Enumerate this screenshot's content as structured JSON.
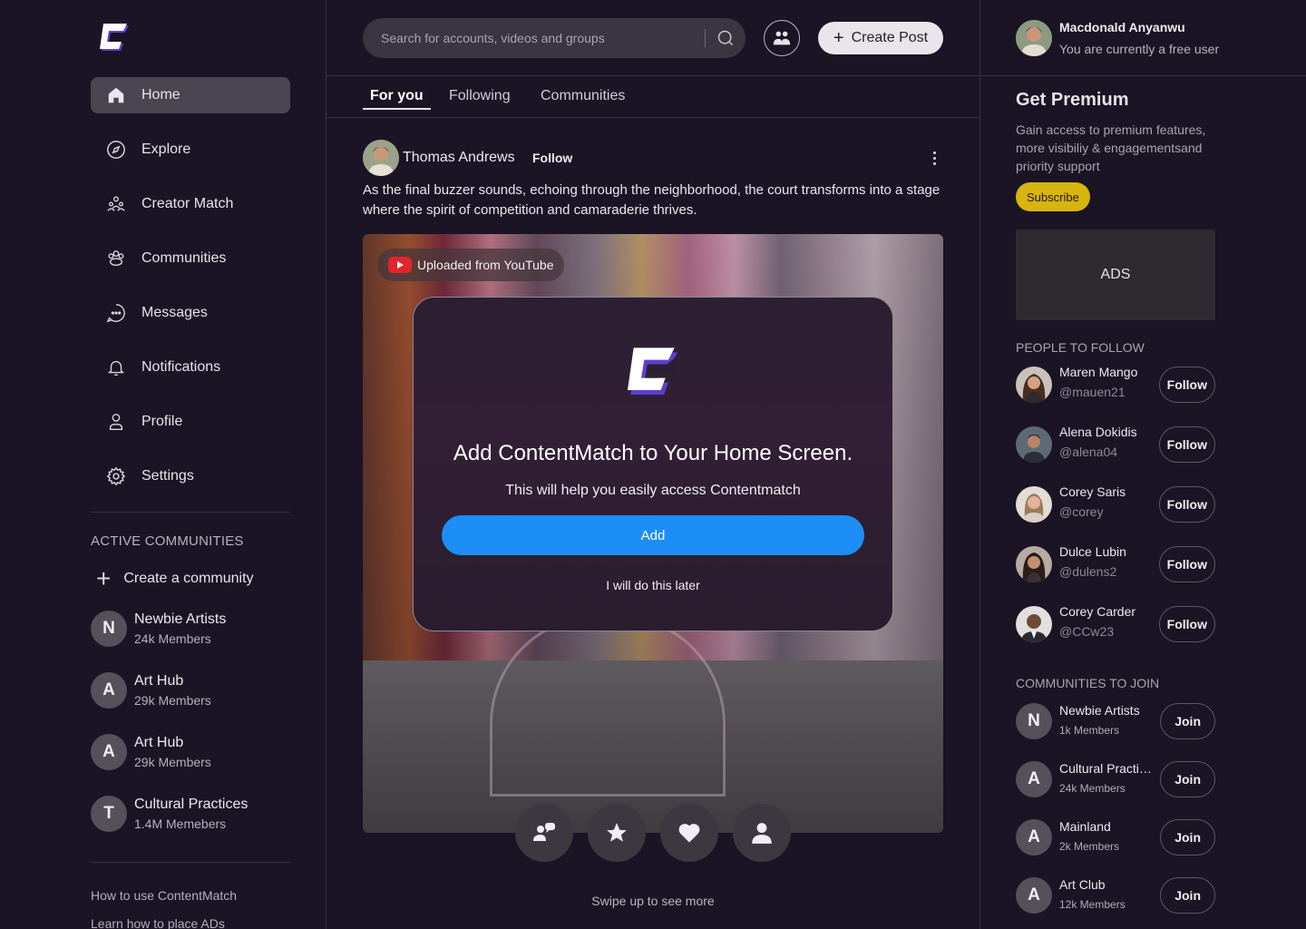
{
  "app": {
    "logo_icon": "contentmatch-logo-icon",
    "accent": "#1d8ef5",
    "premium": "#d8b40f"
  },
  "sidebar": {
    "nav": [
      {
        "label": "Home",
        "icon": "home-icon",
        "active": true
      },
      {
        "label": "Explore",
        "icon": "compass-icon"
      },
      {
        "label": "Creator Match",
        "icon": "creator-match-icon"
      },
      {
        "label": "Communities",
        "icon": "communities-icon"
      },
      {
        "label": "Messages",
        "icon": "chat-icon"
      },
      {
        "label": "Notifications",
        "icon": "bell-icon"
      },
      {
        "label": "Profile",
        "icon": "user-icon"
      },
      {
        "label": "Settings",
        "icon": "gear-icon"
      }
    ],
    "active_communities_title": "ACTIVE COMMUNITIES",
    "create_community": "Create a community",
    "communities": [
      {
        "letter": "N",
        "name": "Newbie Artists",
        "members": "24k Members"
      },
      {
        "letter": "A",
        "name": "Art Hub",
        "members": "29k Members"
      },
      {
        "letter": "A",
        "name": "Art Hub",
        "members": "29k Members"
      },
      {
        "letter": "T",
        "name": "Cultural Practices",
        "members": "1.4M Memebers"
      }
    ],
    "footer_links": [
      "How to use ContentMatch",
      "Learn how to place ADs"
    ]
  },
  "header": {
    "search_placeholder": "Search for accounts, videos and groups",
    "create_post": "Create Post",
    "tabs": [
      "For you",
      "Following",
      "Communities"
    ]
  },
  "post": {
    "author": "Thomas Andrews",
    "follow": "Follow",
    "text": "As the final buzzer sounds, echoing through the neighborhood, the court transforms into a stage where the spirit of competition and camaraderie thrives.",
    "source_chip": "Uploaded from YouTube"
  },
  "modal": {
    "title": "Add ContentMatch to Your Home Screen.",
    "subtitle": "This will help you easily access Contentmatch",
    "add": "Add",
    "later": "I will do this later"
  },
  "actions": [
    "match-icon",
    "star-icon",
    "heart-icon",
    "profile-icon"
  ],
  "swipe_hint": "Swipe up to see more",
  "right": {
    "user_name": "Macdonald Anyanwu",
    "user_status": "You are currently a free user",
    "premium_title": "Get Premium",
    "premium_desc": "Gain access to premium features, more visibiliy & engagementsand priority support",
    "subscribe": "Subscribe",
    "ads": "ADS",
    "people_title": "PEOPLE TO FOLLOW",
    "people": [
      {
        "name": "Maren Mango",
        "handle": "@mauen21",
        "btn": "Follow"
      },
      {
        "name": "Alena Dokidis",
        "handle": "@alena04",
        "btn": "Follow"
      },
      {
        "name": "Corey Saris",
        "handle": "@corey",
        "btn": "Follow"
      },
      {
        "name": "Dulce Lubin",
        "handle": "@dulens2",
        "btn": "Follow"
      },
      {
        "name": "Corey Carder",
        "handle": "@CCw23",
        "btn": "Follow"
      }
    ],
    "communities_title": "COMMUNITIES TO JOIN",
    "communities": [
      {
        "letter": "N",
        "name": "Newbie Artists",
        "members": "1k Members",
        "btn": "Join"
      },
      {
        "letter": "A",
        "name": "Cultural Practices",
        "members": "24k Members",
        "btn": "Join"
      },
      {
        "letter": "A",
        "name": "Mainland",
        "members": "2k Members",
        "btn": "Join"
      },
      {
        "letter": "A",
        "name": "Art Club",
        "members": "12k Members",
        "btn": "Join"
      }
    ]
  }
}
